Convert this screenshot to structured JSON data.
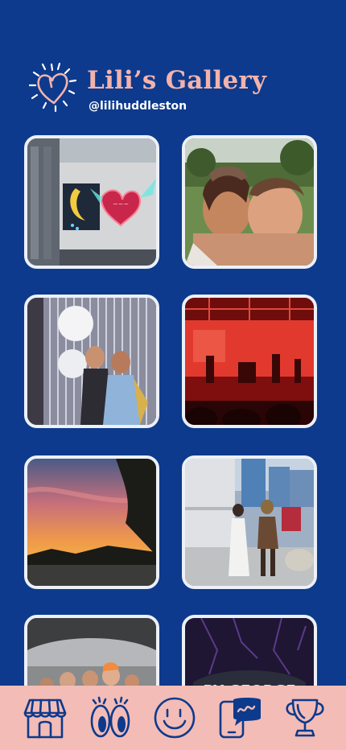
{
  "header": {
    "title": "Lili’s Gallery",
    "handle": "@lilihuddleston",
    "logo_icon": "heart-sparkle-icon"
  },
  "colors": {
    "background": "#0d3a8c",
    "title": "#f3b3ac",
    "tabbar": "#f3bcb6",
    "icon_stroke": "#0d3a8c",
    "photo_border": "#ecf0f7"
  },
  "gallery": [
    {
      "name": "photo-neon-signs-building"
    },
    {
      "name": "photo-two-friends-selfie"
    },
    {
      "name": "photo-balloons-tinsel-party"
    },
    {
      "name": "photo-red-concert-stage"
    },
    {
      "name": "photo-sunset-sky-trees"
    },
    {
      "name": "photo-friends-walking-street"
    },
    {
      "name": "photo-group-under-bridge"
    },
    {
      "name": "photo-night-sign-by-george"
    }
  ],
  "tabbar": {
    "tabs": [
      {
        "icon": "shop-icon"
      },
      {
        "icon": "eyes-icon"
      },
      {
        "icon": "smiley-face-icon"
      },
      {
        "icon": "phone-chat-icon"
      },
      {
        "icon": "trophy-icon"
      }
    ]
  }
}
